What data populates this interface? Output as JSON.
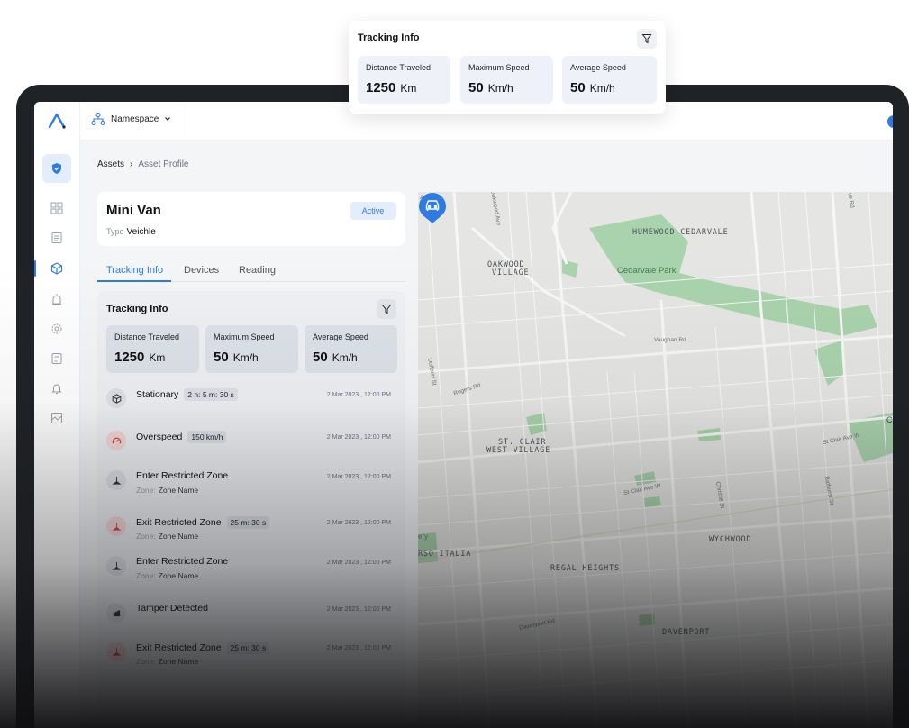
{
  "topbar": {
    "namespace_label": "Namespace"
  },
  "breadcrumb": {
    "root": "Assets",
    "separator": "›",
    "current": "Asset Profile"
  },
  "asset": {
    "name": "Mini Van",
    "type_label": "Type",
    "type_value": "Veichle",
    "status": "Active"
  },
  "tabs": [
    {
      "label": "Tracking Info"
    },
    {
      "label": "Devices"
    },
    {
      "label": "Reading"
    }
  ],
  "tracking": {
    "title": "Tracking Info",
    "stats": [
      {
        "label": "Distance Traveled",
        "value": "1250",
        "unit": "Km"
      },
      {
        "label": "Maximum Speed",
        "value": "50",
        "unit": "Km/h"
      },
      {
        "label": "Average Speed",
        "value": "50",
        "unit": "Km/h"
      }
    ],
    "events": [
      {
        "title": "Stationary",
        "duration": "2 h: 5 m: 30 s",
        "time": "2 Mar 2023 , 12:00 PM"
      },
      {
        "title": "Overspeed",
        "duration": "150 km/h",
        "time": "2 Mar 2023 , 12:00 PM"
      },
      {
        "title": "Enter Restricted Zone",
        "zone_label": "Zone:",
        "zone_value": "Zone Name",
        "time": "2 Mar 2023 , 12:00 PM"
      },
      {
        "title": "Exit Restricted Zone",
        "duration": "25 m: 30 s",
        "zone_label": "Zone:",
        "zone_value": "Zone Name",
        "time": "2 Mar 2023 , 12:00 PM"
      },
      {
        "title": "Enter Restricted Zone",
        "zone_label": "Zone:",
        "zone_value": "Zone Name",
        "time": "2 Mar 2023 , 12:00 PM"
      },
      {
        "title": "Tamper Detected",
        "time": "2 Mar 2023 , 12:00 PM"
      },
      {
        "title": "Exit Restricted Zone",
        "duration": "25 m: 30 s",
        "zone_label": "Zone:",
        "zone_value": "Zone Name",
        "time": "2 Mar 2023 , 12:00 PM"
      }
    ]
  },
  "map": {
    "areas": [
      "HUMEWOOD-CEDARVALE",
      "OAKWOOD",
      "VILLAGE",
      "ST. CLAIR",
      "WEST VILLAGE",
      "WYCHWOOD",
      "RSO ITALIA",
      "REGAL HEIGHTS",
      "DAVENPORT"
    ],
    "park": "Cedarvale Park",
    "streets": [
      "Vaughan Rd",
      "Rogers Rd",
      "Dufferin St",
      "Oakwood Ave",
      "St Clair Ave W",
      "St Clair Ave W",
      "Christie St",
      "Bathurst St",
      "Davenport Rd",
      "Ave W",
      "ve Rd",
      "ery",
      "C"
    ]
  },
  "colors": {
    "accent": "#2f7be0",
    "park": "#a9d3ad"
  }
}
